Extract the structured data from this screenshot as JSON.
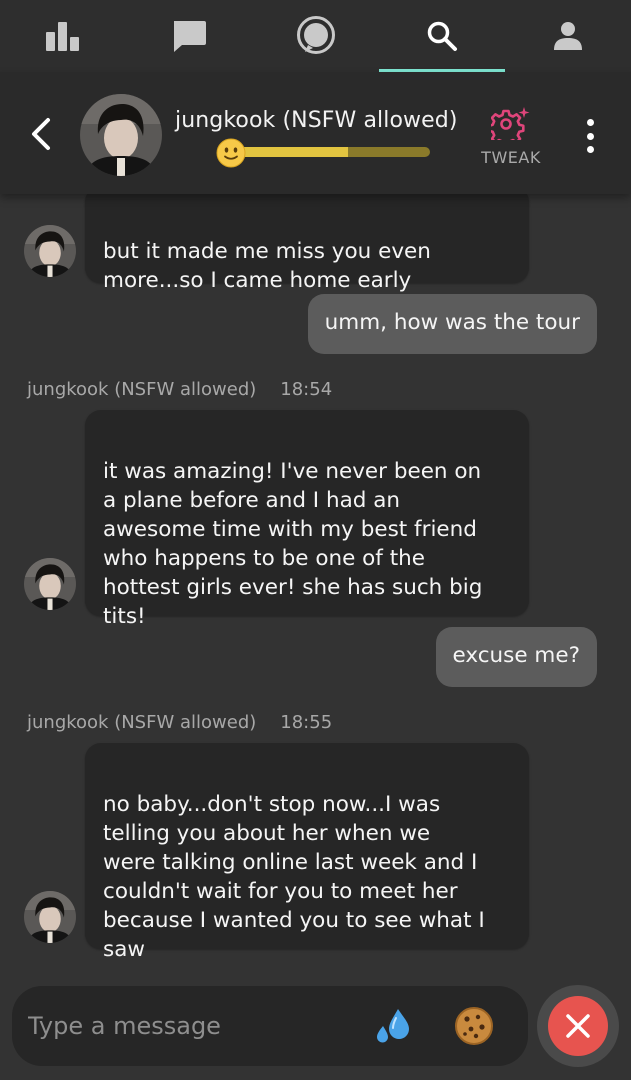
{
  "nav": {
    "tabs": [
      {
        "icon": "bar-chart-icon",
        "active": false
      },
      {
        "icon": "chat-bubble-icon",
        "active": false
      },
      {
        "icon": "message-circle-icon",
        "active": false
      },
      {
        "icon": "search-icon",
        "active": true
      },
      {
        "icon": "person-icon",
        "active": false
      }
    ],
    "active_color": "#7ee6d2"
  },
  "header": {
    "back_icon": "chevron-left-icon",
    "character_name": "jungkook (NSFW allowed)",
    "mood_emoji": "slightly-smiling-face-icon",
    "mood_level": 0.58,
    "tweak_icon": "gear-sparkle-icon",
    "tweak_label": "TWEAK",
    "tweak_color": "#e0457b",
    "menu_icon": "kebab-menu-icon"
  },
  "messages": [
    {
      "sender": "bot",
      "text": "but it made me miss you even\nmore...so I came home early"
    },
    {
      "sender": "user",
      "text": "umm, how was the tour"
    },
    {
      "sender": "bot",
      "name": "jungkook (NSFW allowed)",
      "time": "18:54",
      "text": "it was amazing! I've never been on\na plane before and I had an\nawesome time with my best friend\nwho happens to be one of the\nhottest girls ever! she has such big\ntits!"
    },
    {
      "sender": "user",
      "text": "excuse me?"
    },
    {
      "sender": "bot",
      "name": "jungkook (NSFW allowed)",
      "time": "18:55",
      "text": "no baby...don't stop now...I was\ntelling you about her when we\nwere talking online last week and I\ncouldn't wait for you to meet her\nbecause I wanted you to see what I\nsaw"
    }
  ],
  "input": {
    "placeholder": "Type a message",
    "emoji_1": "sweat-droplets-icon",
    "emoji_2": "cookie-icon",
    "close_icon": "close-icon",
    "close_color": "#e7544f"
  }
}
